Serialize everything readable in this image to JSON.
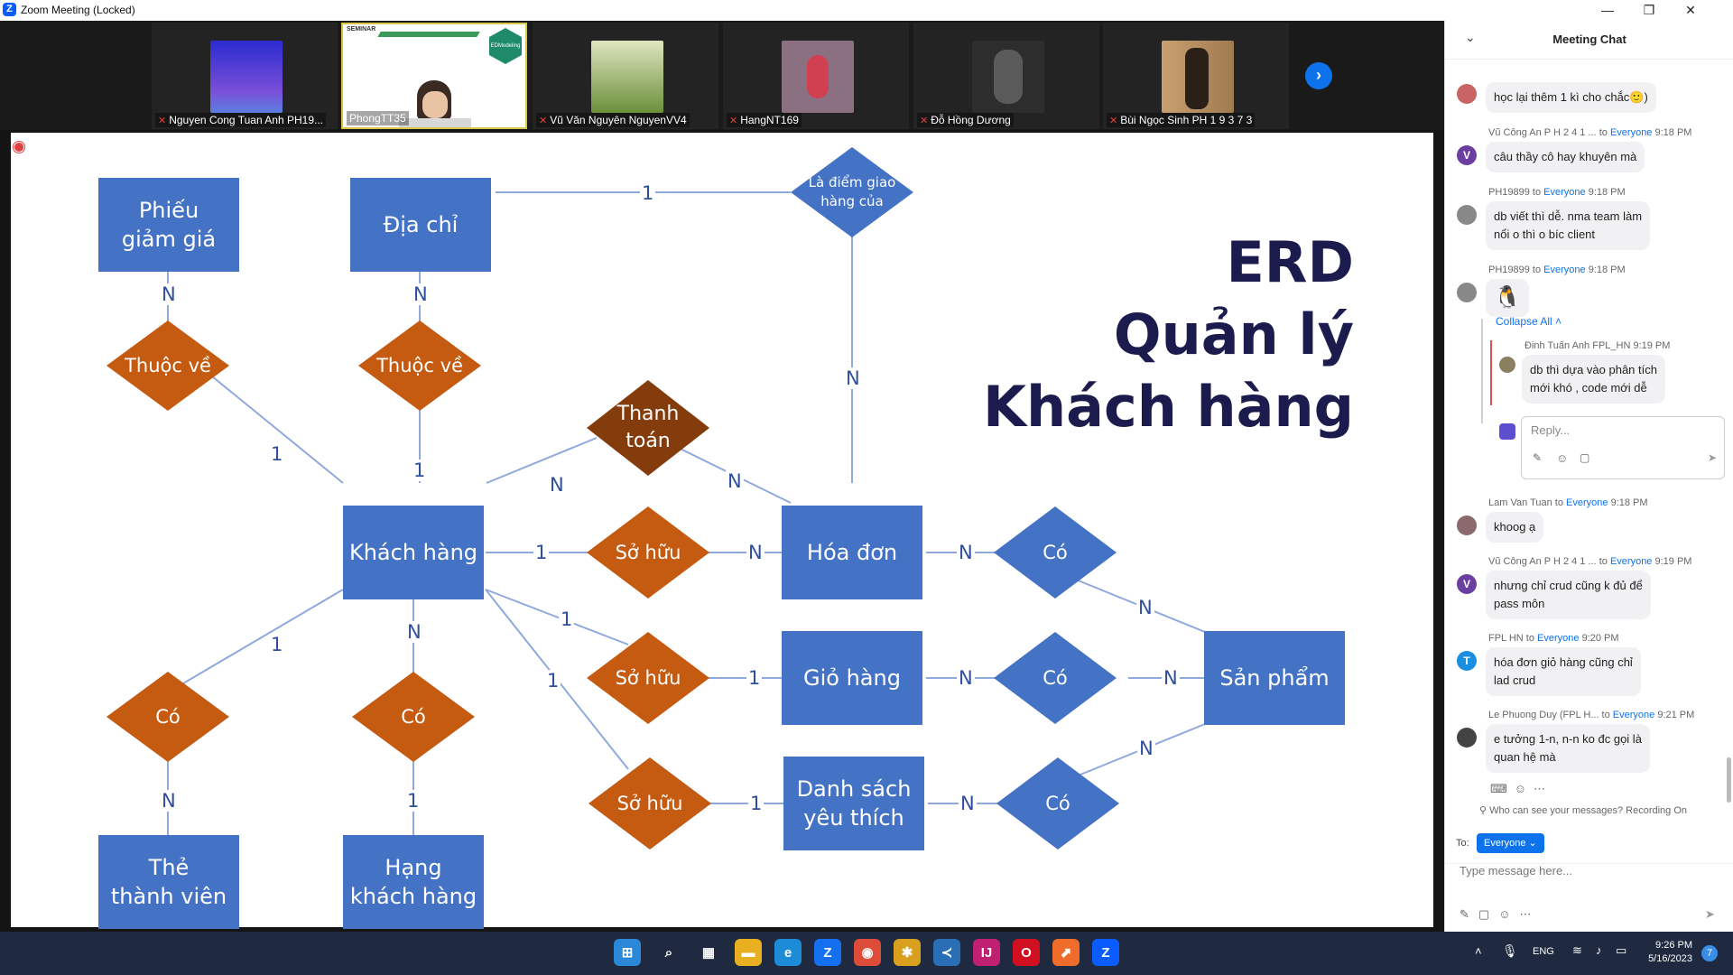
{
  "window": {
    "title": "Zoom Meeting (Locked)"
  },
  "participants": [
    {
      "name": "Nguyen Cong Tuan Anh PH19...",
      "muted": true,
      "avatar_color": "#3b3fd0",
      "avatar_fg": "#c06fe0"
    },
    {
      "name": "PhongTT35",
      "muted": false,
      "active": true,
      "seminar_label": "SEMINAR",
      "badge": "EDModeling"
    },
    {
      "name": "Vũ Văn Nguyên NguyenVV4",
      "muted": true,
      "avatar_color": "#6b8f3a",
      "avatar_fg": "#e6e9a0"
    },
    {
      "name": "HangNT169",
      "muted": true,
      "avatar_color": "#8a7080",
      "avatar_fg": "#d04050"
    },
    {
      "name": "Đỗ Hồng Dương",
      "muted": true,
      "avatar_color": "#2d2d2d",
      "avatar_fg": "#777777"
    },
    {
      "name": "Bùi Ngọc Sinh PH 1 9 3 7 3",
      "muted": true,
      "avatar_color": "#a07a50",
      "avatar_fg": "#3a2a20"
    }
  ],
  "slide": {
    "title_lines": [
      "ERD",
      "Quản lý",
      "Khách hàng"
    ],
    "entities": {
      "phieu": "Phiếu\ngiảm giá",
      "diachi": "Địa chỉ",
      "khachhang": "Khách hàng",
      "hoadon": "Hóa đơn",
      "giohang": "Giỏ hàng",
      "danhsach": "Danh sách\nyêu thích",
      "sanpham": "Sản phẩm",
      "the": "Thẻ\nthành viên",
      "hang": "Hạng\nkhách hàng"
    },
    "relations": {
      "thuocve1": "Thuộc về",
      "thuocve2": "Thuộc về",
      "thanhtoan": "Thanh\ntoán",
      "ladiem": "Là điểm giao\nhàng của",
      "sohuu1": "Sở hữu",
      "sohuu2": "Sở hữu",
      "sohuu3": "Sở hữu",
      "co_hd": "Có",
      "co_gh": "Có",
      "co_ds": "Có",
      "co_the": "Có",
      "co_hang": "Có"
    },
    "cardinalities": {
      "c_phieu": "N",
      "c_phieu_kh": "1",
      "c_dc": "N",
      "c_dc_kh": "1",
      "c_dc_ld": "1",
      "c_ld_hd": "N",
      "c_kh_tt": "N",
      "c_tt_hd": "N",
      "c_kh_sh1": "1",
      "c_sh1_hd": "N",
      "c_kh_sh2": "1",
      "c_sh2_gh": "1",
      "c_kh_sh3": "1",
      "c_sh3_ds": "1",
      "c_hd_co": "N",
      "c_co_sp1": "N",
      "c_gh_co": "N",
      "c_co_sp2": "N",
      "c_ds_co": "N",
      "c_co_sp3": "N",
      "c_kh_cothe": "1",
      "c_cothe_the": "N",
      "c_kh_cohang": "N",
      "c_cohang_hang": "1"
    },
    "colors": {
      "entity": "#4472c4",
      "relation": "#c55a11",
      "relation_dark": "#843c0c",
      "line": "#8fa9dc",
      "title": "#1b1b4d"
    }
  },
  "chat": {
    "title": "Meeting Chat",
    "messages": [
      {
        "text": "học lại thêm 1 kì cho chắc🙂)",
        "avatar_color": "#c86464"
      },
      {
        "sender": "Vũ Công An P H 2 4 1 ...",
        "to": "Everyone",
        "time": "9:18 PM",
        "text": "câu thầy cô hay khuyên mà",
        "avatar": "V",
        "avatar_color": "#6b3fa0"
      },
      {
        "sender": "PH19899",
        "to": "Everyone",
        "time": "9:18 PM",
        "text": "db viết thì dễ. nma team làm\nnổi o thì o bíc client",
        "avatar_color": "#888"
      },
      {
        "sender": "PH19899",
        "to": "Everyone",
        "time": "9:18 PM",
        "text": "🐧",
        "avatar_color": "#888"
      },
      {
        "sender": "Lam Van Tuan",
        "to": "Everyone",
        "time": "9:18 PM",
        "text": "khoog ạ",
        "avatar_color": "#8a6a6a"
      },
      {
        "sender": "Vũ Công An P H 2 4 1 ...",
        "to": "Everyone",
        "time": "9:19 PM",
        "text": "nhưng chỉ crud cũng k đủ để\npass môn",
        "avatar": "V",
        "avatar_color": "#6b3fa0"
      },
      {
        "sender": "FPL HN",
        "to": "Everyone",
        "time": "9:20 PM",
        "text": "hóa đơn giỏ hàng cũng chỉ\nlad crud",
        "avatar": "T",
        "avatar_color": "#1a8fe0"
      },
      {
        "sender": "Le Phuong Duy (FPL H...",
        "to": "Everyone",
        "time": "9:21 PM",
        "text": "e tưởng 1-n, n-n ko đc gọi là\nquan hệ mà",
        "avatar_color": "#444"
      }
    ],
    "thread": {
      "collapse_label": "Collapse All",
      "reply": {
        "sender": "Đinh Tuấn Anh FPL_HN",
        "time": "9:19 PM",
        "text": "db thì dựa vào phân tích\nmới khó , code mới dễ"
      },
      "reply_placeholder": "Reply..."
    },
    "privacy_text": "Who can see your messages? Recording On",
    "to_label": "To:",
    "recipient": "Everyone",
    "input_placeholder": "Type message here..."
  },
  "taskbar": {
    "lang": "ENG",
    "time": "9:26 PM",
    "date": "5/16/2023",
    "notif_count": "7",
    "apps": [
      {
        "name": "windows-start-icon",
        "glyph": "⊞",
        "color": "#2b88d8"
      },
      {
        "name": "search-icon",
        "glyph": "⌕",
        "color": "transparent"
      },
      {
        "name": "widgets-icon",
        "glyph": "▦",
        "color": "transparent"
      },
      {
        "name": "file-explorer-icon",
        "glyph": "▬",
        "color": "#e8b020"
      },
      {
        "name": "edge-icon",
        "glyph": "e",
        "color": "#1c8cd8"
      },
      {
        "name": "zalo-icon",
        "glyph": "Z",
        "color": "#1570ef"
      },
      {
        "name": "chrome-icon",
        "glyph": "◉",
        "color": "#dd4b39"
      },
      {
        "name": "app-icon",
        "glyph": "✱",
        "color": "#d9a020"
      },
      {
        "name": "vscode-icon",
        "glyph": "≺",
        "color": "#2a6fb5"
      },
      {
        "name": "intellij-icon",
        "glyph": "IJ",
        "color": "#c02070"
      },
      {
        "name": "opera-icon",
        "glyph": "O",
        "color": "#d01020"
      },
      {
        "name": "postman-icon",
        "glyph": "⬈",
        "color": "#ef6c2b"
      },
      {
        "name": "zoom-icon",
        "glyph": "Z",
        "color": "#0b5cff"
      }
    ]
  }
}
